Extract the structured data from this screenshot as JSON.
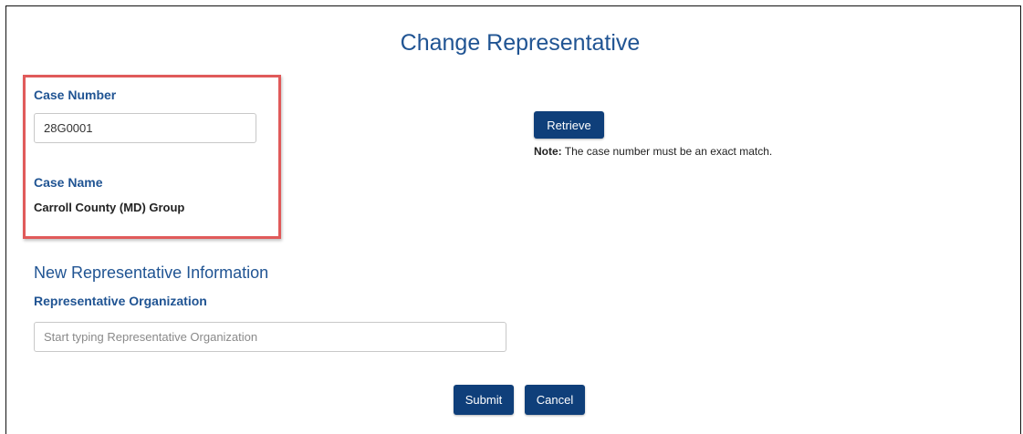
{
  "page": {
    "title": "Change Representative"
  },
  "case": {
    "number_label": "Case Number",
    "number_value": "28G0001",
    "name_label": "Case Name",
    "name_value": "Carroll County (MD) Group"
  },
  "retrieve": {
    "button_label": "Retrieve",
    "note_prefix": "Note:",
    "note_text": " The case number must be an exact match."
  },
  "new_rep": {
    "section_title": "New Representative Information",
    "org_label": "Representative Organization",
    "org_value": "",
    "org_placeholder": "Start typing Representative Organization"
  },
  "actions": {
    "submit_label": "Submit",
    "cancel_label": "Cancel"
  },
  "colors": {
    "heading": "#205493",
    "button": "#0f3f7a",
    "highlight": "#e05a5a"
  }
}
